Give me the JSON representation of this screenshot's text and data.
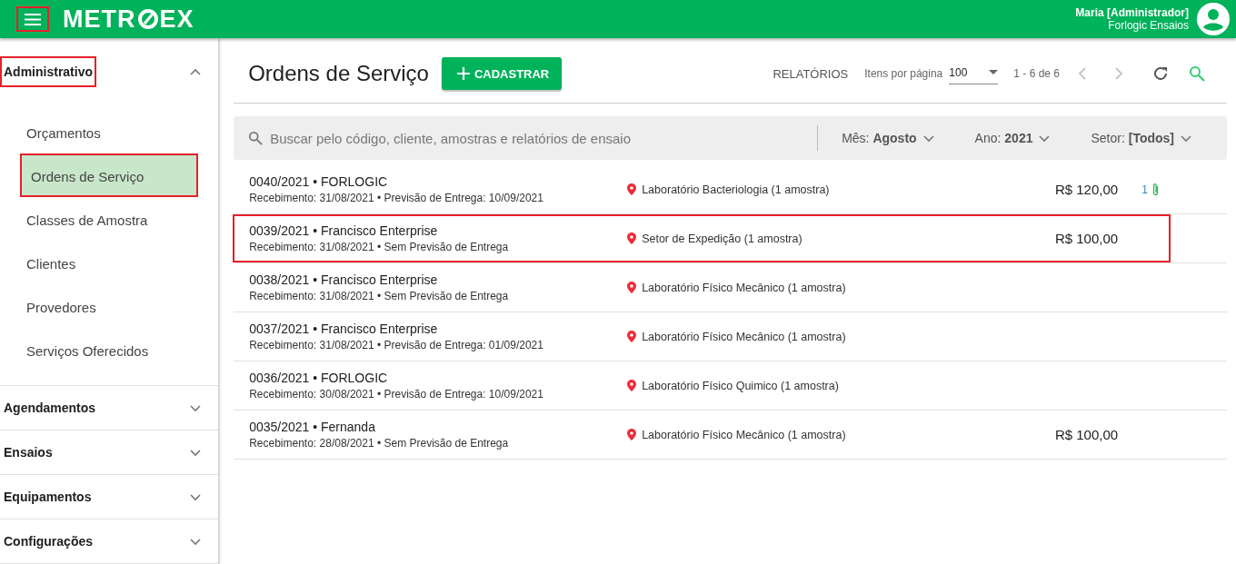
{
  "header": {
    "menu_highlighted": true,
    "logo": [
      "METR",
      "EX"
    ],
    "user_name": "Maria [Administrador]",
    "company": "Forlogic Ensaios"
  },
  "sidebar": {
    "sections": [
      {
        "label": "Administrativo",
        "expanded": true,
        "highlighted": true,
        "items": [
          {
            "label": "Orçamentos",
            "selected": false,
            "highlighted": false
          },
          {
            "label": "Ordens de Serviço",
            "selected": true,
            "highlighted": true
          },
          {
            "label": "Classes de Amostra",
            "selected": false,
            "highlighted": false
          },
          {
            "label": "Clientes",
            "selected": false,
            "highlighted": false
          },
          {
            "label": "Provedores",
            "selected": false,
            "highlighted": false
          },
          {
            "label": "Serviços Oferecidos",
            "selected": false,
            "highlighted": false
          }
        ]
      },
      {
        "label": "Agendamentos",
        "expanded": false,
        "highlighted": false
      },
      {
        "label": "Ensaios",
        "expanded": false,
        "highlighted": false
      },
      {
        "label": "Equipamentos",
        "expanded": false,
        "highlighted": false
      },
      {
        "label": "Configurações",
        "expanded": false,
        "highlighted": false
      }
    ]
  },
  "page": {
    "title": "Ordens de Serviço",
    "add_button": "CADASTRAR",
    "reports": "RELATÓRIOS",
    "items_per_page_label": "Itens por página",
    "items_per_page": "100",
    "range": "1 - 6 de 6",
    "prev_disabled": true,
    "next_disabled": true
  },
  "filters": {
    "search_placeholder": "Buscar pelo código, cliente, amostras e relatórios de ensaio",
    "month": "Mês: **Agosto**",
    "year": "Ano: **2021**",
    "sector": "Setor: **[Todos]**"
  },
  "orders": [
    {
      "title": "0040/2021 • FORLOGIC",
      "dates": "Recebimento: 31/08/2021 • Previsão de Entrega: 10/09/2021",
      "location": "Laboratório Bacteriologia (1 amostra)",
      "price": "R$ 120,00",
      "attachments": "1",
      "highlighted": false
    },
    {
      "title": "0039/2021 • Francisco Enterprise",
      "dates": "Recebimento: 31/08/2021 • Sem Previsão de Entrega",
      "location": "Setor de Expedição (1 amostra)",
      "price": "R$ 100,00",
      "highlighted": true
    },
    {
      "title": "0038/2021 • Francisco Enterprise",
      "dates": "Recebimento: 31/08/2021 • Sem Previsão de Entrega",
      "location": "Laboratório Físico Mecânico (1 amostra)",
      "highlighted": false
    },
    {
      "title": "0037/2021 • Francisco Enterprise",
      "dates": "Recebimento: 31/08/2021 • Previsão de Entrega: 01/09/2021",
      "location": "Laboratório Físico Mecânico (1 amostra)",
      "highlighted": false
    },
    {
      "title": "0036/2021 • FORLOGIC",
      "dates": "Recebimento: 30/08/2021 • Previsão de Entrega: 10/09/2021",
      "location": "Laboratório Físico Quimico (1 amostra)",
      "highlighted": false
    },
    {
      "title": "0035/2021 • Fernanda",
      "dates": "Recebimento: 28/08/2021 • Sem Previsão de Entrega",
      "location": "Laboratório Físico Mecânico (1 amostra)",
      "price": "R$ 100,00",
      "highlighted": false
    }
  ]
}
